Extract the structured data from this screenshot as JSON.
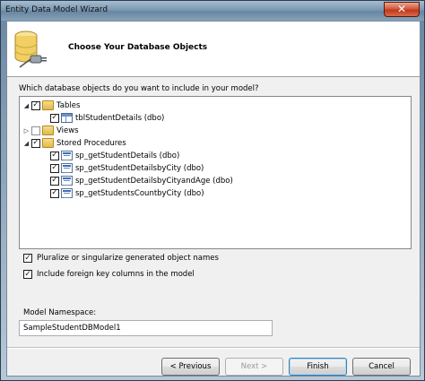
{
  "window": {
    "title": "Entity Data Model Wizard",
    "close_glyph": "✕"
  },
  "header": {
    "title": "Choose Your Database Objects",
    "icon": "database-connection-icon"
  },
  "prompt": "Which database objects do you want to include in your model?",
  "tree": {
    "tables": {
      "label": "Tables",
      "checked": true,
      "expanded": true,
      "children": [
        {
          "label": "tblStudentDetails (dbo)",
          "checked": true
        }
      ]
    },
    "views": {
      "label": "Views",
      "checked": false,
      "expanded": false
    },
    "procedures": {
      "label": "Stored Procedures",
      "checked": true,
      "expanded": true,
      "children": [
        {
          "label": "sp_getStudentDetails (dbo)",
          "checked": true
        },
        {
          "label": "sp_getStudentDetailsbyCity (dbo)",
          "checked": true
        },
        {
          "label": "sp_getStudentDetailsbyCityandAge (dbo)",
          "checked": true
        },
        {
          "label": "sp_getStudentsCountbyCity (dbo)",
          "checked": true
        }
      ]
    }
  },
  "options": {
    "pluralize": {
      "label": "Pluralize or singularize generated object names",
      "checked": true
    },
    "foreign_keys": {
      "label": "Include foreign key columns in the model",
      "checked": true
    }
  },
  "namespace": {
    "label": "Model Namespace:",
    "value": "SampleStudentDBModel1"
  },
  "buttons": {
    "previous": "< Previous",
    "next": "Next >",
    "finish": "Finish",
    "cancel": "Cancel"
  },
  "glyphs": {
    "check": "✓",
    "collapse": "◢",
    "expand": "▷"
  }
}
